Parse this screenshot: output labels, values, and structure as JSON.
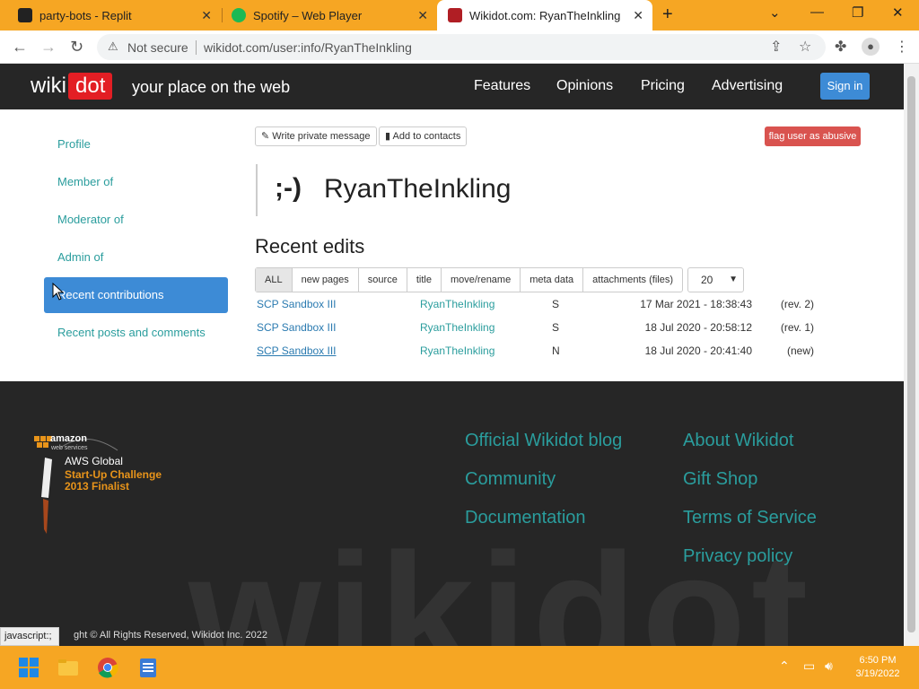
{
  "browser": {
    "tabs": [
      {
        "title": "party-bots - Replit"
      },
      {
        "title": "Spotify – Web Player"
      },
      {
        "title": "Wikidot.com: RyanTheInkling"
      }
    ],
    "address": {
      "security": "Not secure",
      "url": "wikidot.com/user:info/RyanTheInkling"
    }
  },
  "header": {
    "logo_wiki": "wiki",
    "logo_dot": "dot",
    "tagline": "your place on the web",
    "nav": [
      "Features",
      "Opinions",
      "Pricing",
      "Advertising"
    ],
    "signin": "Sign in"
  },
  "sidebar": {
    "items": [
      "Profile",
      "Member of",
      "Moderator of",
      "Admin of",
      "Recent contributions",
      "Recent posts and comments"
    ],
    "active_index": 4
  },
  "actions": {
    "write_message": "Write private message",
    "add_contacts": "Add to contacts",
    "flag": "flag user as abusive"
  },
  "user": {
    "smiley": ";-)",
    "name": "RyanTheInkling"
  },
  "recent": {
    "title": "Recent edits",
    "filters": [
      "ALL",
      "new pages",
      "source",
      "title",
      "move/rename",
      "meta data",
      "attachments (files)"
    ],
    "per_page": "20",
    "rows": [
      {
        "page": "SCP Sandbox III",
        "user": "RyanTheInkling",
        "flag": "S",
        "date": "17 Mar 2021 - 18:38:43",
        "rev": "(rev. 2)"
      },
      {
        "page": "SCP Sandbox III",
        "user": "RyanTheInkling",
        "flag": "S",
        "date": "18 Jul 2020 - 20:58:12",
        "rev": "(rev. 1)"
      },
      {
        "page": "SCP Sandbox III",
        "user": "RyanTheInkling",
        "flag": "N",
        "date": "18 Jul 2020 - 20:41:40",
        "rev": "(new)"
      }
    ]
  },
  "footer": {
    "aws": {
      "line1": "amazon",
      "line2": "web services",
      "line3": "AWS Global",
      "line4": "Start-Up Challenge",
      "line5": "2013 Finalist"
    },
    "links_left": [
      "Official Wikidot blog",
      "Community",
      "Documentation"
    ],
    "links_right": [
      "About Wikidot",
      "Gift Shop",
      "Terms of Service",
      "Privacy policy"
    ],
    "watermark": "wikidot",
    "copyright": "ght © All Rights Reserved, Wikidot Inc. 2022",
    "status_hint": "javascript:;"
  },
  "taskbar": {
    "time": "6:50 PM",
    "date": "3/19/2022"
  },
  "colors": {
    "tabbar": "#f6a623",
    "link": "#2a9d9d",
    "accent": "#3d8bd6",
    "flag": "#d9534f",
    "header": "#262626"
  }
}
